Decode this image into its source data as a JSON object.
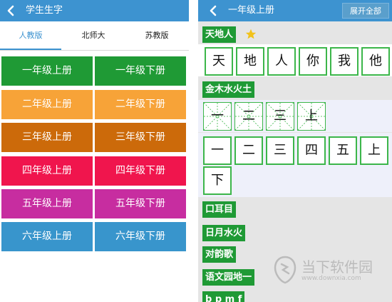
{
  "left": {
    "title": "学生生字",
    "tabs": [
      "人教版",
      "北师大",
      "苏教版"
    ],
    "grades": [
      {
        "up": "一年级上册",
        "down": "一年级下册",
        "color": "#1f9a35"
      },
      {
        "up": "二年级上册",
        "down": "二年级下册",
        "color": "#f7a338"
      },
      {
        "up": "三年级上册",
        "down": "三年级下册",
        "color": "#cc6a0a"
      },
      {
        "up": "四年级上册",
        "down": "四年级下册",
        "color": "#f0154d"
      },
      {
        "up": "五年级上册",
        "down": "五年级下册",
        "color": "#c72da0"
      },
      {
        "up": "六年级上册",
        "down": "六年级下册",
        "color": "#3895cc"
      }
    ]
  },
  "right": {
    "title": "一年级上册",
    "expand_label": "展开全部",
    "groups": [
      {
        "title": "天地人",
        "chars": [
          "天",
          "地",
          "人",
          "你",
          "我",
          "他"
        ]
      },
      {
        "title": "金木水火土",
        "tian_chars": [
          "一",
          "二",
          "三",
          "上"
        ],
        "chars": [
          "一",
          "二",
          "三",
          "四",
          "五",
          "上",
          "下"
        ]
      },
      {
        "title": "口耳目"
      },
      {
        "title": "日月水火"
      },
      {
        "title": "对韵歌"
      },
      {
        "title": "语文园地一"
      },
      {
        "title": "b p m f"
      }
    ]
  },
  "watermark": {
    "text": "当下软件园",
    "url": "www.downxia.com"
  },
  "colors": {
    "bar": "#3d93d0",
    "green": "#1f9a35",
    "card_border": "#3cb64a",
    "star": "#f2c21a"
  }
}
